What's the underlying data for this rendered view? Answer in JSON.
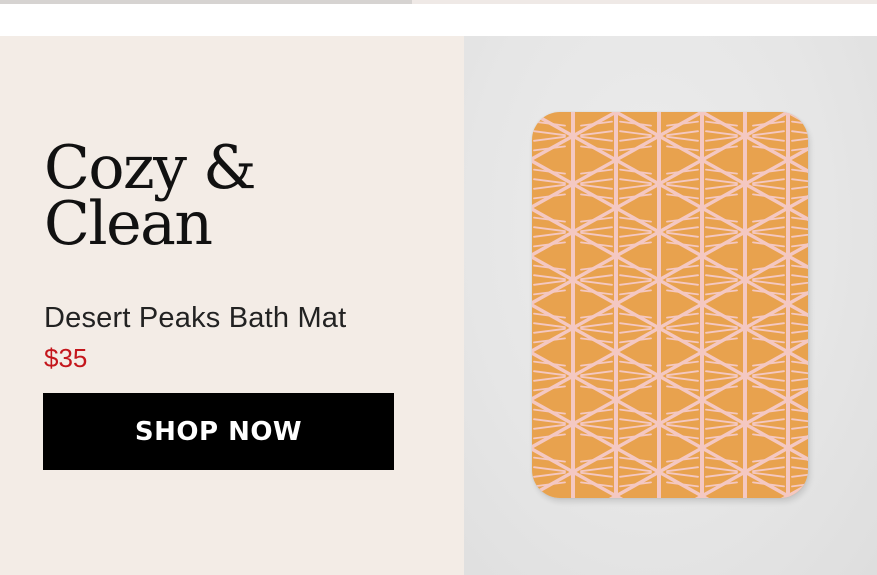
{
  "banner": {
    "headline": [
      "Cozy &",
      "Clean"
    ],
    "product_name": "Desert Peaks Bath Mat",
    "price": "$35",
    "cta_label": "SHOP NOW"
  },
  "product_image": {
    "pattern": "orange-chevron-stripes",
    "colors": {
      "base": "#e8a24e",
      "lines": "#f4c8c2"
    }
  },
  "colors": {
    "left_background": "#f3ece6",
    "right_background": "#e6e6e6",
    "price": "#c4161c",
    "button": "#000000",
    "button_text": "#ffffff"
  }
}
